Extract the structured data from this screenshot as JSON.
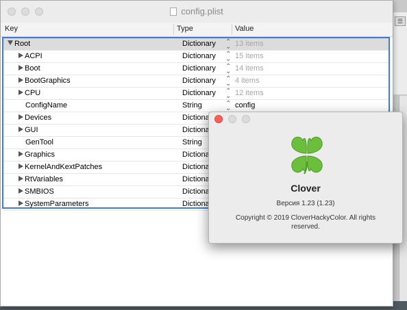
{
  "window": {
    "title": "config.plist",
    "columns": {
      "key": "Key",
      "type": "Type",
      "value": "Value"
    },
    "rows": [
      {
        "key": "Root",
        "type": "Dictionary",
        "value": "13 items",
        "expanded": true,
        "indent": 0,
        "selected": true
      },
      {
        "key": "ACPI",
        "type": "Dictionary",
        "value": "15 items",
        "indent": 1
      },
      {
        "key": "Boot",
        "type": "Dictionary",
        "value": "14 items",
        "indent": 1
      },
      {
        "key": "BootGraphics",
        "type": "Dictionary",
        "value": "4 items",
        "indent": 1
      },
      {
        "key": "CPU",
        "type": "Dictionary",
        "value": "12 items",
        "indent": 1
      },
      {
        "key": "ConfigName",
        "type": "String",
        "value": "config",
        "indent": 1,
        "leaf": true
      },
      {
        "key": "Devices",
        "type": "Dictionary",
        "value": "",
        "indent": 1
      },
      {
        "key": "GUI",
        "type": "Dictionary",
        "value": "",
        "indent": 1
      },
      {
        "key": "GenTool",
        "type": "String",
        "value": "",
        "indent": 1,
        "leaf": true
      },
      {
        "key": "Graphics",
        "type": "Dictionary",
        "value": "",
        "indent": 1
      },
      {
        "key": "KernelAndKextPatches",
        "type": "Dictionary",
        "value": "",
        "indent": 1
      },
      {
        "key": "RtVariables",
        "type": "Dictionary",
        "value": "",
        "indent": 1
      },
      {
        "key": "SMBIOS",
        "type": "Dictionary",
        "value": "",
        "indent": 1
      },
      {
        "key": "SystemParameters",
        "type": "Dictionary",
        "value": "",
        "indent": 1
      }
    ]
  },
  "about": {
    "app_name": "Clover",
    "version": "Версия 1.23 (1.23)",
    "copyright": "Copyright © 2019 CloverHackyColor. All rights reserved."
  },
  "colors": {
    "accent": "#3d7be0",
    "close_button": "#fc605b",
    "clover_green": "#6cbf3c"
  }
}
